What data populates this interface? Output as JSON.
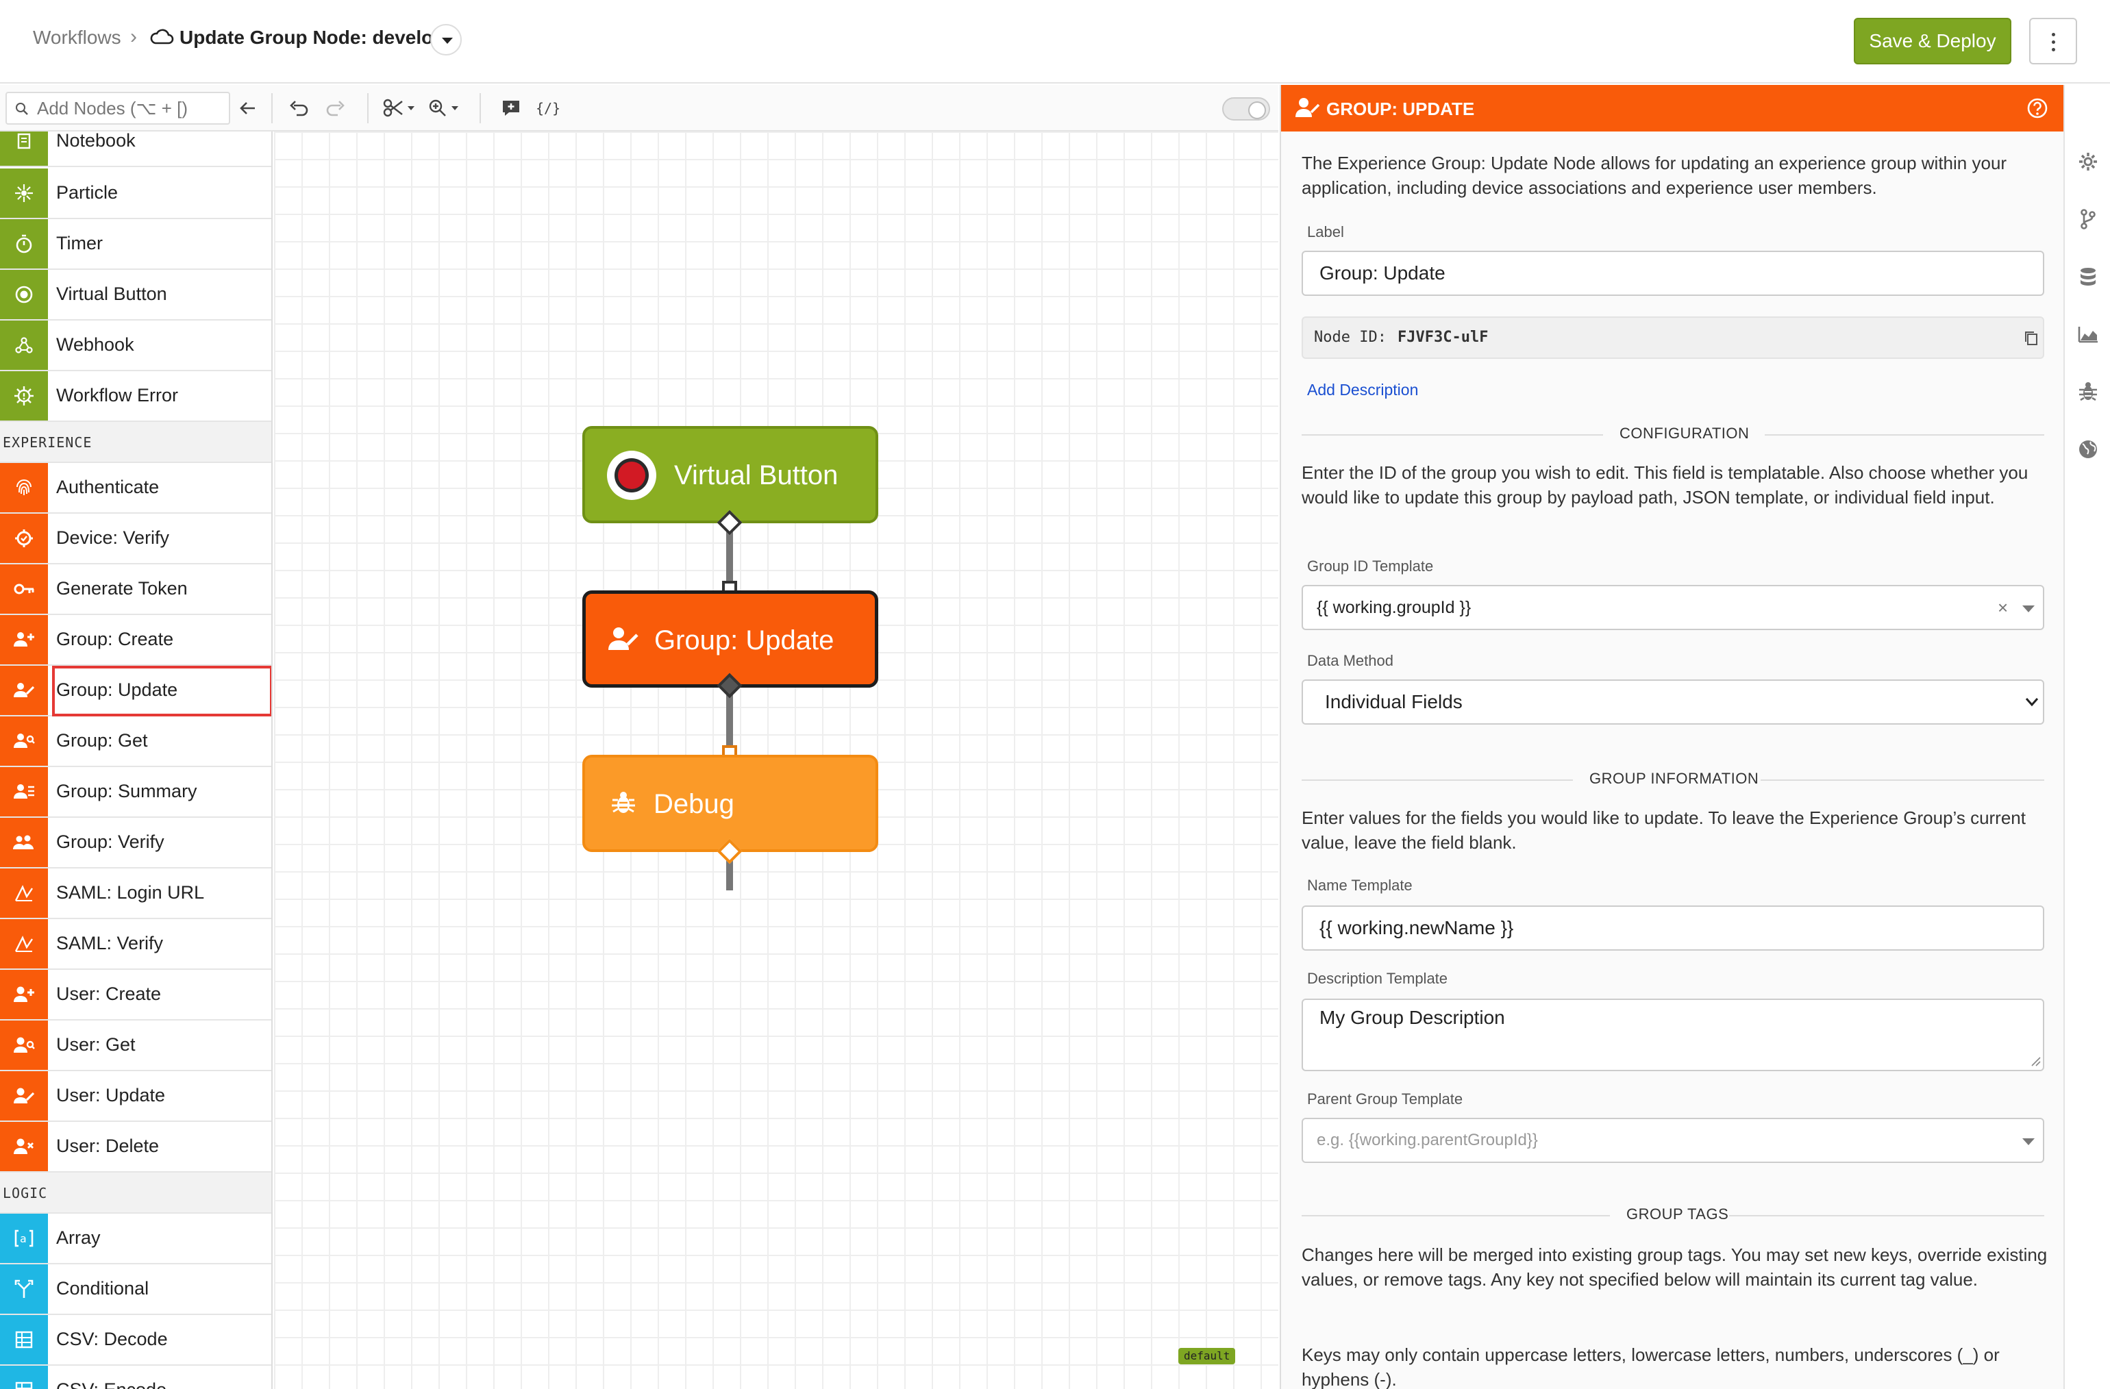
{
  "header": {
    "breadcrumb_root": "Workflows",
    "breadcrumb_sep": "›",
    "title": "Update Group Node: develop",
    "save_deploy_label": "Save & Deploy"
  },
  "toolbar": {
    "search_placeholder": "Add Nodes (⌥ + [)",
    "buttons": [
      "back-arrow-icon",
      "undo-icon",
      "redo-icon",
      "scissors-icon",
      "zoom-icon",
      "add-comment-icon",
      "template-icon"
    ]
  },
  "palette": {
    "items_top": [
      {
        "label": "Notebook",
        "icon": "notebook-icon"
      },
      {
        "label": "Particle",
        "icon": "particle-icon"
      },
      {
        "label": "Timer",
        "icon": "timer-icon"
      },
      {
        "label": "Virtual Button",
        "icon": "virtual-button-icon"
      },
      {
        "label": "Webhook",
        "icon": "webhook-icon"
      },
      {
        "label": "Workflow Error",
        "icon": "workflow-error-icon"
      }
    ],
    "category_experience": "EXPERIENCE",
    "items_experience": [
      {
        "label": "Authenticate",
        "icon": "fingerprint-icon"
      },
      {
        "label": "Device: Verify",
        "icon": "device-verify-icon"
      },
      {
        "label": "Generate Token",
        "icon": "key-icon"
      },
      {
        "label": "Group: Create",
        "icon": "group-create-icon"
      },
      {
        "label": "Group: Update",
        "icon": "group-update-icon"
      },
      {
        "label": "Group: Get",
        "icon": "group-get-icon"
      },
      {
        "label": "Group: Summary",
        "icon": "group-summary-icon"
      },
      {
        "label": "Group: Verify",
        "icon": "group-verify-icon"
      },
      {
        "label": "SAML: Login URL",
        "icon": "saml-login-icon"
      },
      {
        "label": "SAML: Verify",
        "icon": "saml-verify-icon"
      },
      {
        "label": "User: Create",
        "icon": "user-create-icon"
      },
      {
        "label": "User: Get",
        "icon": "user-get-icon"
      },
      {
        "label": "User: Update",
        "icon": "user-update-icon"
      },
      {
        "label": "User: Delete",
        "icon": "user-delete-icon"
      }
    ],
    "category_logic": "LOGIC",
    "items_logic": [
      {
        "label": "Array",
        "icon": "array-icon"
      },
      {
        "label": "Conditional",
        "icon": "conditional-icon"
      },
      {
        "label": "CSV: Decode",
        "icon": "csv-decode-icon"
      },
      {
        "label": "CSV: Encode",
        "icon": "csv-encode-icon"
      }
    ]
  },
  "canvas": {
    "nodes": [
      {
        "label": "Virtual Button",
        "color": "#8aae22"
      },
      {
        "label": "Group: Update",
        "color": "#f95b0a"
      },
      {
        "label": "Debug",
        "color": "#fb9a28"
      }
    ],
    "badge": "default"
  },
  "panel": {
    "title": "Group: Update",
    "description": "The Experience Group: Update Node allows for updating an experience group within your application, including device associations and experience user members.",
    "label_field_label": "Label",
    "label_field_value": "Group: Update",
    "node_id_prefix": "Node ID:",
    "node_id": "FJVF3C-ulF",
    "add_description": "Add Description",
    "section_configuration": "CONFIGURATION",
    "configuration_text": "Enter the ID of the group you wish to edit. This field is templatable. Also choose whether you would like to update this group by payload path, JSON template, or individual field input.",
    "group_id_label": "Group ID Template",
    "group_id_value": "{{ working.groupId }}",
    "data_method_label": "Data Method",
    "data_method_value": "Individual Fields",
    "section_group_info": "GROUP INFORMATION",
    "group_info_text": "Enter values for the fields you would like to update. To leave the Experience Group’s current value, leave the field blank.",
    "name_template_label": "Name Template",
    "name_template_value": "{{ working.newName }}",
    "description_template_label": "Description Template",
    "description_template_value": "My Group Description",
    "parent_group_label": "Parent Group Template",
    "parent_group_placeholder": "e.g. {{working.parentGroupId}}",
    "section_group_tags": "GROUP TAGS",
    "group_tags_text": "Changes here will be merged into existing group tags. You may set new keys, override existing values, or remove tags. Any key not specified below will maintain its current tag value.",
    "keys_text": "Keys may only contain uppercase letters, lowercase letters, numbers, underscores (_) or hyphens (-)."
  },
  "colors": {
    "accent_green": "#7ea622",
    "accent_orange": "#f95b0a",
    "debug_orange": "#fb9a28",
    "logic_cyan": "#1fb7e4",
    "selected_outline": "#e53935"
  },
  "rail": {
    "icons": [
      "settings-gear-icon",
      "versions-branch-icon",
      "storage-database-icon",
      "stats-chart-icon",
      "debug-bug-icon",
      "globe-icon"
    ]
  }
}
